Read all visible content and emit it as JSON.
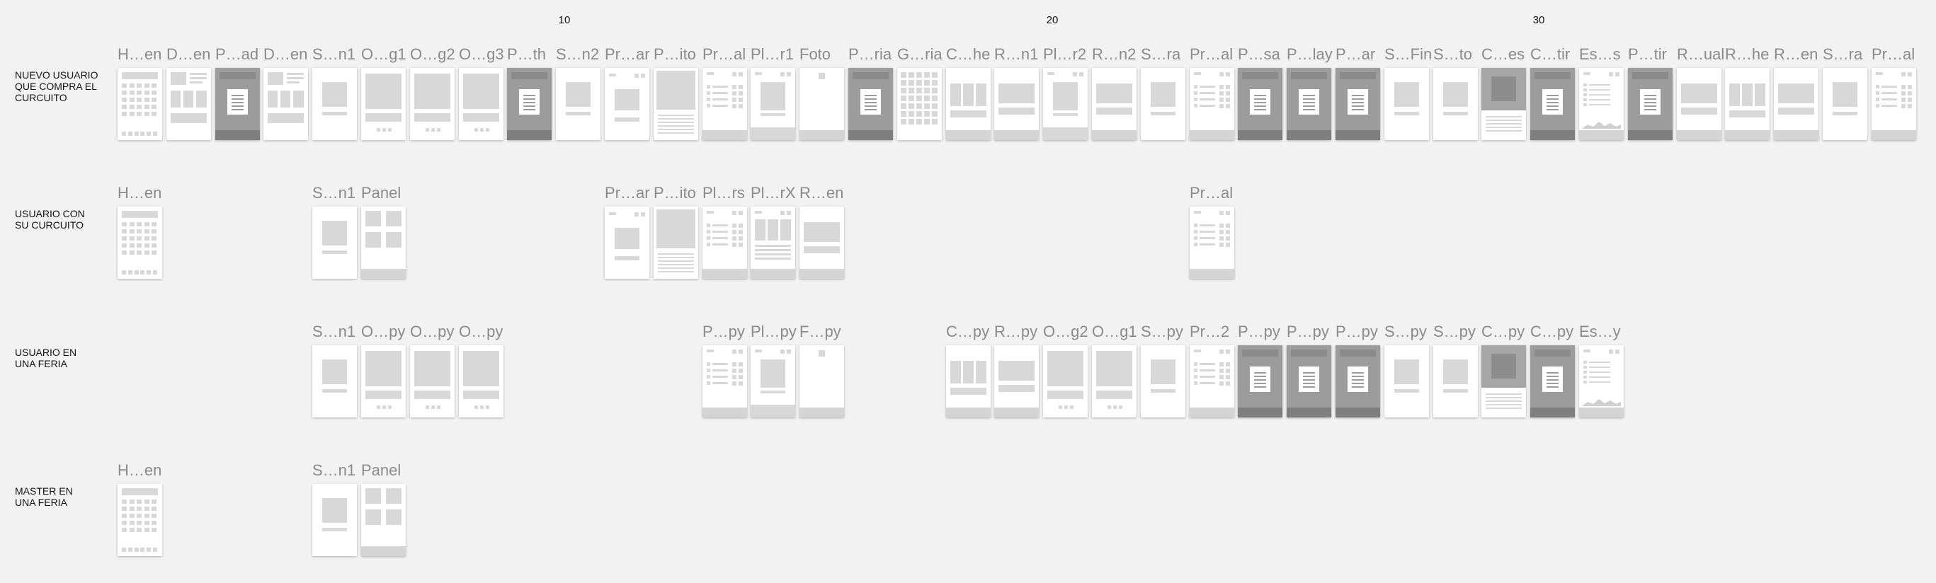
{
  "column_numbers": [
    "10",
    "20",
    "30"
  ],
  "rows": [
    {
      "label": "NUEVO USUARIO\nQUE COMPRA EL\nCURCUITO",
      "screens": [
        {
          "title": "H…en",
          "thumb": "grid",
          "dark": false
        },
        {
          "title": "D…en",
          "thumb": "detail",
          "dark": false
        },
        {
          "title": "P…ad",
          "thumb": "modal",
          "dark": true
        },
        {
          "title": "D…en",
          "thumb": "detail",
          "dark": false
        },
        {
          "title": "S…n1",
          "thumb": "simple",
          "dark": false
        },
        {
          "title": "O…g1",
          "thumb": "big",
          "dark": false
        },
        {
          "title": "O…g2",
          "thumb": "big",
          "dark": false
        },
        {
          "title": "O…g3",
          "thumb": "big",
          "dark": false
        },
        {
          "title": "P…th",
          "thumb": "modal",
          "dark": true
        },
        {
          "title": "S…n2",
          "thumb": "simple",
          "dark": false
        },
        {
          "title": "Pr…ar",
          "thumb": "form",
          "dark": false
        },
        {
          "title": "P…ito",
          "thumb": "photo",
          "dark": false
        },
        {
          "title": "Pr…al",
          "thumb": "list",
          "dark": false
        },
        {
          "title": "Pl…r1",
          "thumb": "player",
          "dark": false
        },
        {
          "title": "Foto",
          "thumb": "photo-blank",
          "dark": false
        },
        {
          "title": "P…ria",
          "thumb": "modal",
          "dark": true
        },
        {
          "title": "G…ria",
          "thumb": "gallery",
          "dark": false
        },
        {
          "title": "C…he",
          "thumb": "cols",
          "dark": false
        },
        {
          "title": "R…n1",
          "thumb": "result",
          "dark": false
        },
        {
          "title": "Pl…r2",
          "thumb": "player",
          "dark": false
        },
        {
          "title": "R…n2",
          "thumb": "result",
          "dark": false
        },
        {
          "title": "S…ra",
          "thumb": "simple",
          "dark": false
        },
        {
          "title": "Pr…al",
          "thumb": "list",
          "dark": false
        },
        {
          "title": "P…sa",
          "thumb": "modal",
          "dark": true
        },
        {
          "title": "P…lay",
          "thumb": "modal",
          "dark": true
        },
        {
          "title": "P…ar",
          "thumb": "modal",
          "dark": true
        },
        {
          "title": "S…Fin",
          "thumb": "simple",
          "dark": false
        },
        {
          "title": "S…to",
          "thumb": "simple",
          "dark": false
        },
        {
          "title": "C…es",
          "thumb": "chart-box",
          "dark": false
        },
        {
          "title": "C…tir",
          "thumb": "modal",
          "dark": true
        },
        {
          "title": "Es…s",
          "thumb": "stats",
          "dark": false
        },
        {
          "title": "P…tir",
          "thumb": "modal",
          "dark": true
        },
        {
          "title": "R…ual",
          "thumb": "result",
          "dark": false
        },
        {
          "title": "R…he",
          "thumb": "cols",
          "dark": false
        },
        {
          "title": "R…en",
          "thumb": "result",
          "dark": false
        },
        {
          "title": "S…ra",
          "thumb": "simple",
          "dark": false
        },
        {
          "title": "Pr…al",
          "thumb": "list",
          "dark": false
        }
      ]
    },
    {
      "label": "USUARIO CON\nSU CURCUITO",
      "screens": [
        {
          "title": "H…en",
          "thumb": "grid",
          "dark": false
        },
        {
          "title": "S…n1",
          "thumb": "simple",
          "dark": false
        },
        {
          "title": "Panel",
          "thumb": "panel",
          "dark": false
        },
        {
          "title": "Pr…ar",
          "thumb": "form",
          "dark": false
        },
        {
          "title": "P…ito",
          "thumb": "photo",
          "dark": false
        },
        {
          "title": "Pl…rs",
          "thumb": "list",
          "dark": false
        },
        {
          "title": "Pl…rX",
          "thumb": "cols-list",
          "dark": false
        },
        {
          "title": "R…en",
          "thumb": "result",
          "dark": false
        },
        {
          "title": "Pr…al",
          "thumb": "list",
          "dark": false
        }
      ]
    },
    {
      "label": "USUARIO EN\nUNA FERIA",
      "screens": [
        {
          "title": "S…n1",
          "thumb": "simple",
          "dark": false
        },
        {
          "title": "O…py",
          "thumb": "big",
          "dark": false
        },
        {
          "title": "O…py",
          "thumb": "big",
          "dark": false
        },
        {
          "title": "O…py",
          "thumb": "big",
          "dark": false
        },
        {
          "title": "P…py",
          "thumb": "list",
          "dark": false
        },
        {
          "title": "Pl…py",
          "thumb": "player",
          "dark": false
        },
        {
          "title": "F…py",
          "thumb": "photo-blank",
          "dark": false
        },
        {
          "title": "C…py",
          "thumb": "cols",
          "dark": false
        },
        {
          "title": "R…py",
          "thumb": "result",
          "dark": false
        },
        {
          "title": "O…g2",
          "thumb": "big",
          "dark": false
        },
        {
          "title": "O…g1",
          "thumb": "big",
          "dark": false
        },
        {
          "title": "S…py",
          "thumb": "simple",
          "dark": false
        },
        {
          "title": "Pr…2",
          "thumb": "list",
          "dark": false
        },
        {
          "title": "P…py",
          "thumb": "modal",
          "dark": true
        },
        {
          "title": "P…py",
          "thumb": "modal",
          "dark": true
        },
        {
          "title": "P…py",
          "thumb": "modal",
          "dark": true
        },
        {
          "title": "S…py",
          "thumb": "simple",
          "dark": false
        },
        {
          "title": "S…py",
          "thumb": "simple",
          "dark": false
        },
        {
          "title": "C…py",
          "thumb": "chart-box",
          "dark": false
        },
        {
          "title": "C…py",
          "thumb": "modal",
          "dark": true
        },
        {
          "title": "Es…y",
          "thumb": "stats",
          "dark": false
        }
      ]
    },
    {
      "label": "MASTER EN\nUNA FERIA",
      "screens": [
        {
          "title": "H…en",
          "thumb": "grid",
          "dark": false
        },
        {
          "title": "S…n1",
          "thumb": "simple",
          "dark": false
        },
        {
          "title": "Panel",
          "thumb": "panel",
          "dark": false
        }
      ]
    }
  ]
}
